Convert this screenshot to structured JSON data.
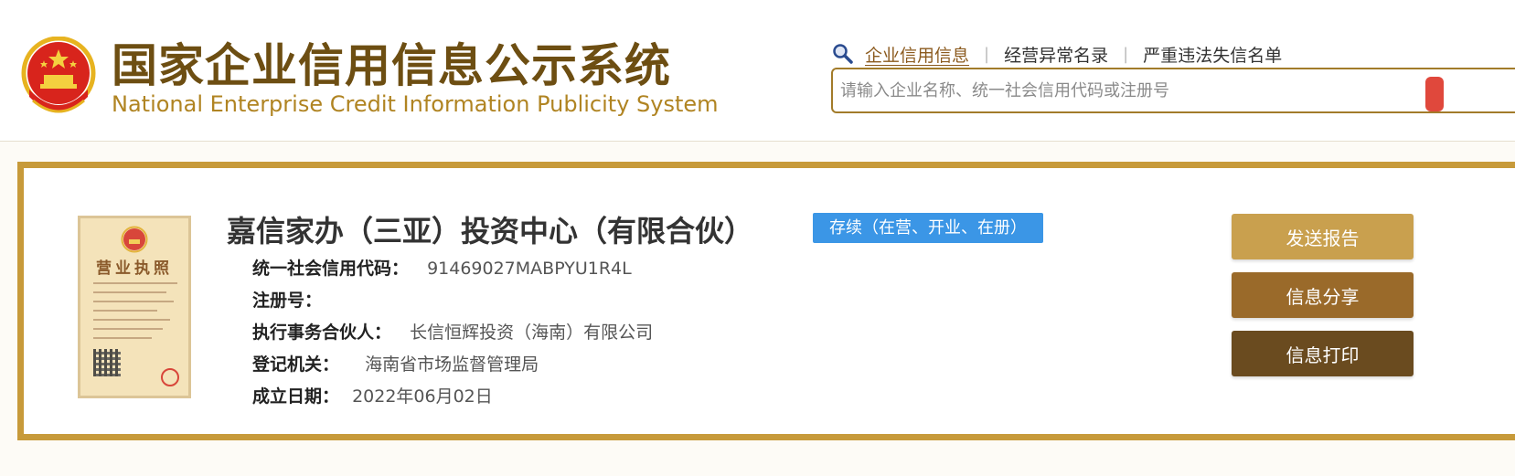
{
  "header": {
    "title_cn": "国家企业信用信息公示系统",
    "title_en": "National Enterprise Credit Information Publicity System",
    "emblem_icon": "national-emblem-icon",
    "nav": {
      "search_icon": "search-icon",
      "items": [
        {
          "label": "企业信用信息",
          "active": true
        },
        {
          "label": "经营异常名录",
          "active": false
        },
        {
          "label": "严重违法失信名单",
          "active": false
        }
      ],
      "separator": "|"
    },
    "search": {
      "placeholder": "请输入企业名称、统一社会信用代码或注册号",
      "value": ""
    }
  },
  "company": {
    "license_image": {
      "icon": "business-license-icon",
      "title": "营业执照"
    },
    "name": "嘉信家办（三亚）投资中心（有限合伙）",
    "status": "存续（在营、开业、在册）",
    "fields": [
      {
        "label": "统一社会信用代码：",
        "value": "91469027MABPYU1R4L"
      },
      {
        "label": "注册号：",
        "value": ""
      },
      {
        "label": "执行事务合伙人：",
        "value": "长信恒辉投资（海南）有限公司"
      },
      {
        "label": "登记机关：",
        "value": "海南省市场监督管理局"
      },
      {
        "label": "成立日期：",
        "value": "2022年06月02日"
      }
    ]
  },
  "actions": {
    "report": "发送报告",
    "share": "信息分享",
    "print": "信息打印"
  },
  "colors": {
    "brand_brown": "#6d4e12",
    "brand_gold": "#b08422",
    "card_border": "#c79a3a",
    "status_blue": "#3b96e6",
    "btn_report": "#c9a04e",
    "btn_share": "#9a6a2a",
    "btn_print": "#6a4b1f"
  }
}
